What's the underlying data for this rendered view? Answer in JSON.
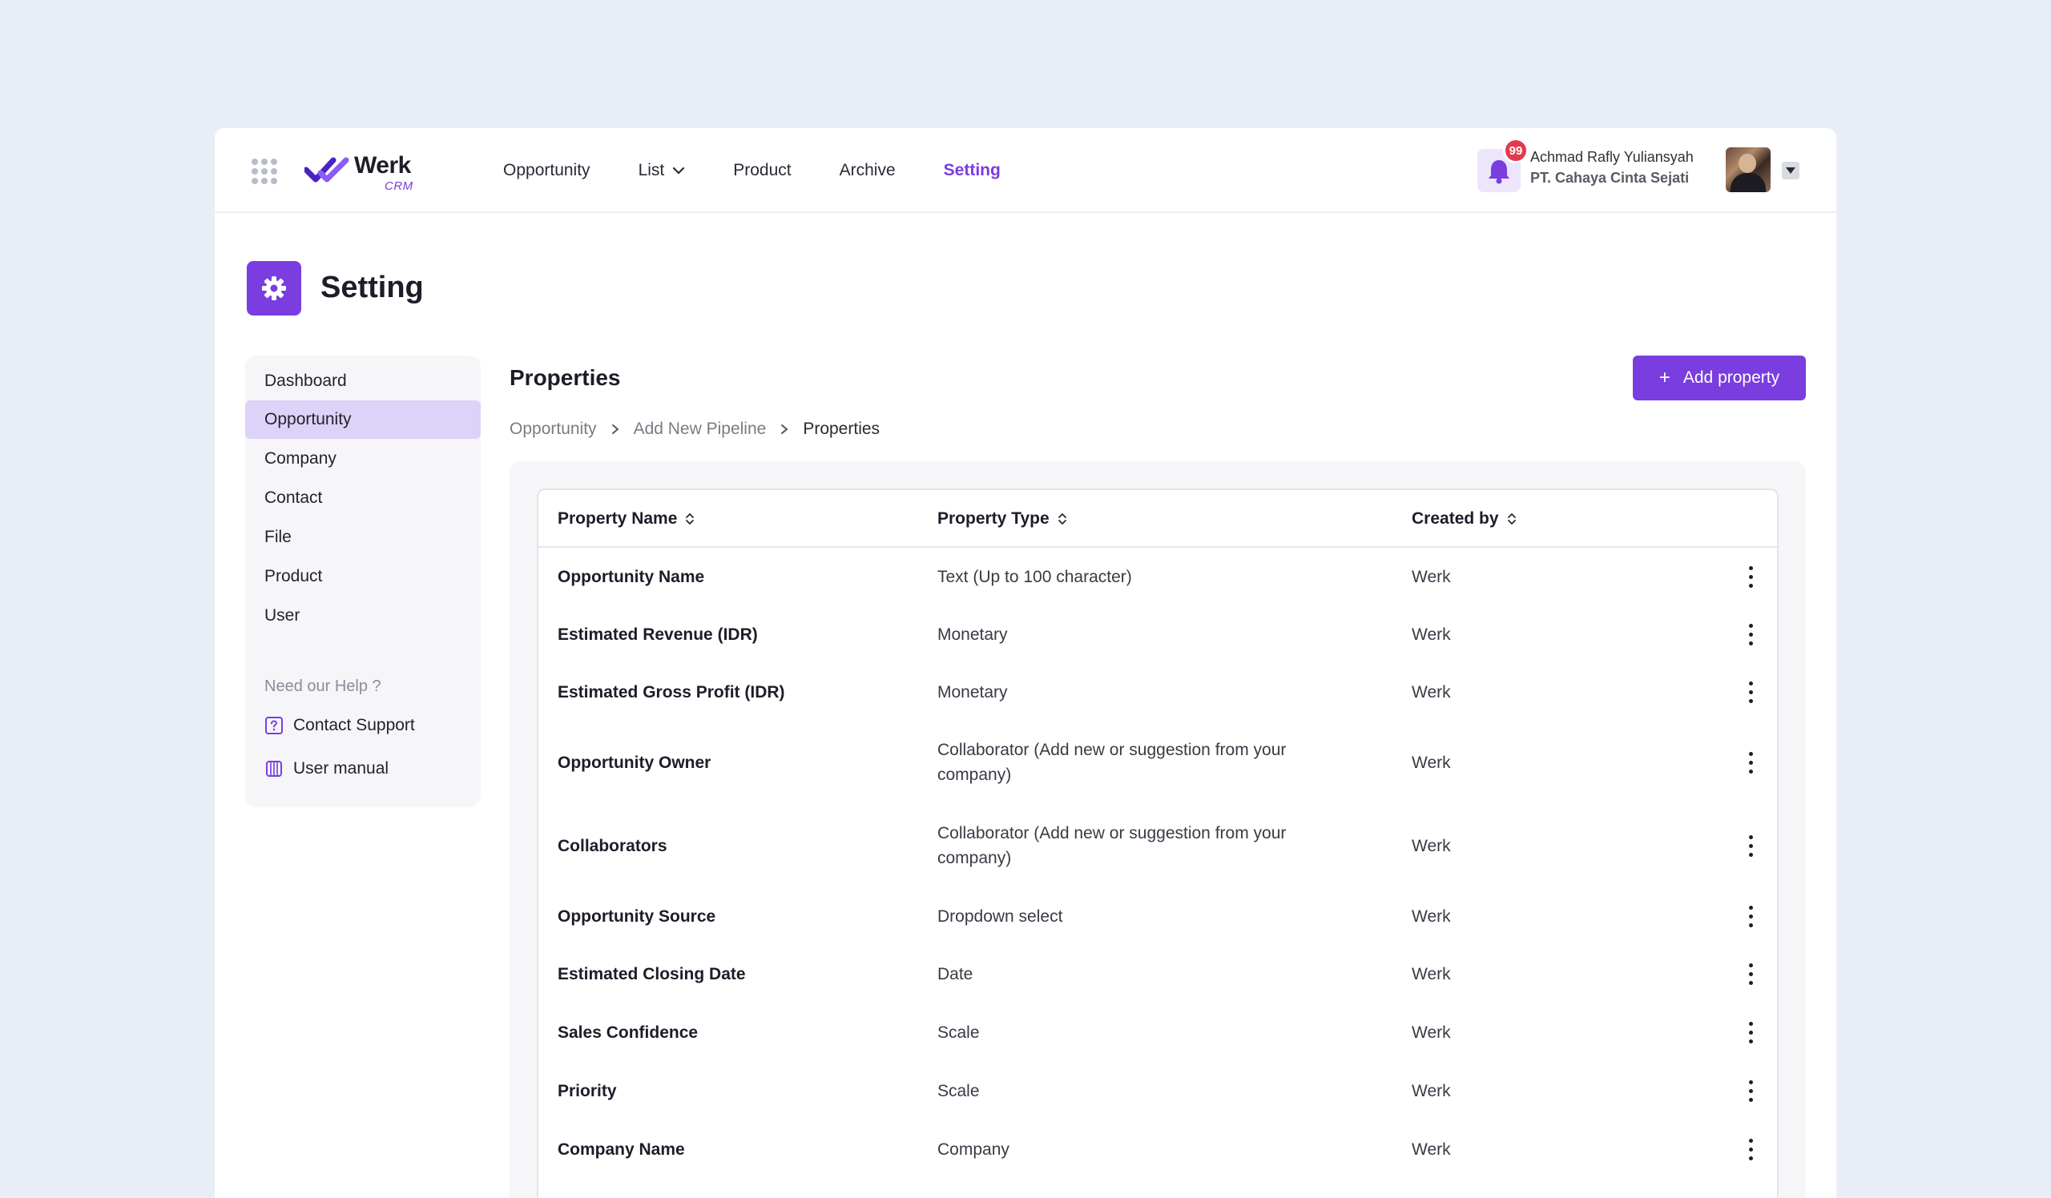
{
  "app": {
    "logo_name": "Werk",
    "logo_sub": "CRM",
    "accent_color": "#7a3de0"
  },
  "nav": {
    "items": [
      {
        "label": "Opportunity"
      },
      {
        "label": "List"
      },
      {
        "label": "Product"
      },
      {
        "label": "Archive"
      },
      {
        "label": "Setting"
      }
    ],
    "active": "Setting"
  },
  "user": {
    "notification_count": "99",
    "name": "Achmad Rafly Yuliansyah",
    "company": "PT. Cahaya Cinta Sejati"
  },
  "page": {
    "title": "Setting",
    "icon": "gear-icon"
  },
  "sidebar": {
    "items": [
      {
        "label": "Dashboard"
      },
      {
        "label": "Opportunity"
      },
      {
        "label": "Company"
      },
      {
        "label": "Contact"
      },
      {
        "label": "File"
      },
      {
        "label": "Product"
      },
      {
        "label": "User"
      }
    ],
    "active": "Opportunity",
    "help_label": "Need our Help ?",
    "help_items": [
      {
        "label": "Contact Support",
        "icon": "question-icon"
      },
      {
        "label": "User manual",
        "icon": "book-icon"
      }
    ]
  },
  "properties": {
    "title": "Properties",
    "add_button": "Add property",
    "breadcrumb": [
      "Opportunity",
      "Add New Pipeline",
      "Properties"
    ],
    "columns": {
      "name": "Property Name",
      "type": "Property Type",
      "created_by": "Created by"
    },
    "rows": [
      {
        "name": "Opportunity Name",
        "type": "Text (Up to 100 character)",
        "created_by": "Werk"
      },
      {
        "name": "Estimated Revenue (IDR)",
        "type": "Monetary",
        "created_by": "Werk"
      },
      {
        "name": "Estimated Gross Profit (IDR)",
        "type": "Monetary",
        "created_by": "Werk"
      },
      {
        "name": "Opportunity Owner",
        "type": "Collaborator (Add new or suggestion from your company)",
        "created_by": "Werk"
      },
      {
        "name": "Collaborators",
        "type": "Collaborator (Add new or suggestion from your company)",
        "created_by": "Werk"
      },
      {
        "name": "Opportunity Source",
        "type": "Dropdown select",
        "created_by": "Werk"
      },
      {
        "name": "Estimated Closing Date",
        "type": "Date",
        "created_by": "Werk"
      },
      {
        "name": "Sales Confidence",
        "type": "Scale",
        "created_by": "Werk"
      },
      {
        "name": "Priority",
        "type": "Scale",
        "created_by": "Werk"
      },
      {
        "name": "Company Name",
        "type": "Company",
        "created_by": "Werk"
      }
    ]
  }
}
